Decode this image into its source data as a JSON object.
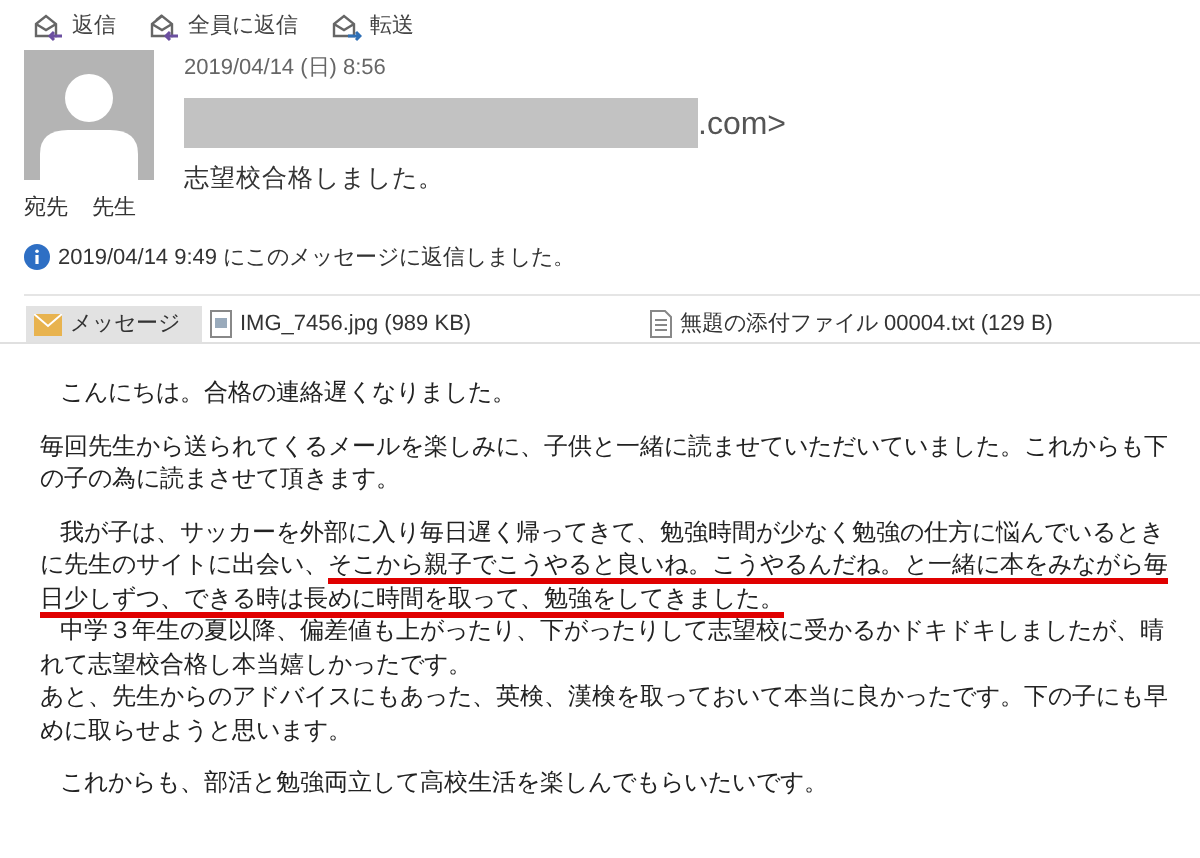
{
  "toolbar": [
    {
      "label": "返信",
      "kind": "reply"
    },
    {
      "label": "全員に返信",
      "kind": "reply_all"
    },
    {
      "label": "転送",
      "kind": "forward"
    }
  ],
  "message": {
    "date": "2019/04/14 (日) 8:56",
    "sender_suffix": ".com>",
    "sender_redacted": true,
    "subject": "志望校合格しました。",
    "to_label": "宛先",
    "to": "先生",
    "info": "2019/04/14 9:49 にこのメッセージに返信しました。"
  },
  "attachments": [
    {
      "label": "メッセージ",
      "kind": "message",
      "selected": true
    },
    {
      "label": "IMG_7456.jpg (989 KB)",
      "kind": "image",
      "selected": false
    },
    {
      "label": "無題の添付ファイル 00004.txt (129 B)",
      "kind": "text",
      "selected": false
    }
  ],
  "body": [
    {
      "indented": true,
      "spaced": false,
      "parts": [
        {
          "text": "こんにちは。合格の連絡遅くなりました。",
          "underlined": false
        }
      ]
    },
    {
      "indented": false,
      "spaced": true,
      "parts": [
        {
          "text": "毎回先生から送られてくるメールを楽しみに、子供と一緒に読ませていただいていました。これからも下の子の為に読まさせて頂きます。",
          "underlined": false
        }
      ]
    },
    {
      "indented": true,
      "spaced": true,
      "parts": [
        {
          "text": "我が子は、サッカーを外部に入り毎日遅く帰ってきて、勉強時間が少なく勉強の仕方に悩んでいるときに先生のサイトに出会い、",
          "underlined": false
        },
        {
          "text": "そこから親子でこうやると良いね。こうやるんだね。と一緒に本をみながら毎日少しずつ、できる時は長めに時間を取って、勉強をしてきました。",
          "underlined": true
        }
      ]
    },
    {
      "indented": true,
      "spaced": false,
      "parts": [
        {
          "text": "中学３年生の夏以降、偏差値も上がったり、下がったりして志望校に受かるかドキドキしましたが、晴れて志望校合格し本当嬉しかったです。",
          "underlined": false
        }
      ]
    },
    {
      "indented": false,
      "spaced": false,
      "parts": [
        {
          "text": "あと、先生からのアドバイスにもあった、英検、漢検を取っておいて本当に良かったです。下の子にも早めに取らせようと思います。",
          "underlined": false
        }
      ]
    },
    {
      "indented": true,
      "spaced": true,
      "parts": [
        {
          "text": "これからも、部活と勉強両立して高校生活を楽しんでもらいたいです。",
          "underlined": false
        }
      ]
    }
  ]
}
